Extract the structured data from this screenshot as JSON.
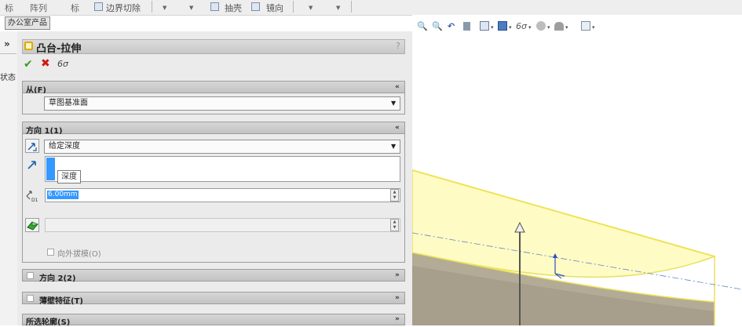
{
  "toolbar": {
    "partial_left": "标",
    "partial_item": "阵列",
    "partial_item2": "标",
    "boundary_cut": "边界切除",
    "shell": "抽壳",
    "mirror": "镜向"
  },
  "left_tabs": {
    "office_products": "办公室产品",
    "collapse": "»",
    "status": "状态"
  },
  "property_manager": {
    "title": "凸台-拉伸",
    "help": "?",
    "ok": "✔",
    "cancel": "✖",
    "preview": "6σ"
  },
  "from_group": {
    "title": "从(F)",
    "chevron": "«",
    "value": "草图基准面"
  },
  "direction1": {
    "title": "方向 1(1)",
    "chevron": "«",
    "end_condition": "给定深度",
    "tooltip": "深度",
    "depth_icon_label": "D1",
    "depth_value": "6.00mm",
    "draft_outward": "向外拔模(O)"
  },
  "direction2": {
    "title": "方向 2(2)",
    "chevron": "»"
  },
  "thin_feature": {
    "title": "薄壁特征(T)",
    "chevron": "»"
  },
  "selected_contours": {
    "title": "所选轮廓(S)",
    "chevron": "»"
  },
  "colors": {
    "body_fill": "#fffbc4",
    "body_edge": "#e8e060",
    "side_face": "#c0b8a4",
    "selection": "#3399ff"
  }
}
